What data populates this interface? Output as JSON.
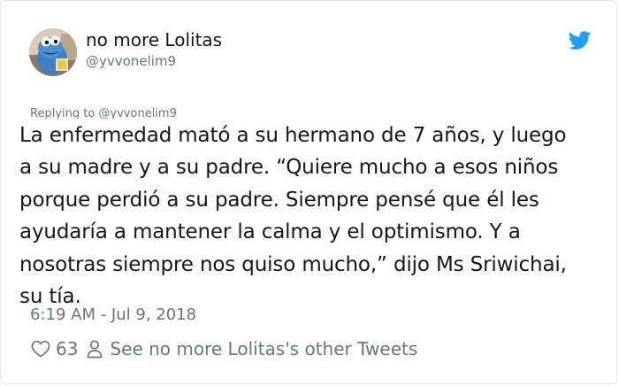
{
  "user": {
    "display_name": "no more Lolitas",
    "handle": "@yvvonelim9"
  },
  "replying_to": "Replying to @yvvonelim9",
  "tweet": {
    "lines": [
      "La enfermedad mató a su hermano de 7 años, y luego",
      "a su madre y a su padre. “Quiere mucho a esos niños",
      "porque perdió a su padre. Siempre pensé que él les",
      "ayudaría a mantener la calma y el optimismo. Y a",
      "nosotras siempre nos quiso mucho,” dijo Ms Sriwichai,",
      "su tía."
    ],
    "timestamp": "6:19 AM - Jul 9, 2018"
  },
  "actions": {
    "like_count": "63",
    "other_tweets_label": "See no more Lolitas's other Tweets"
  },
  "colors": {
    "twitter_blue": "#1da1f2",
    "text_primary": "#14171a",
    "text_secondary": "#657786"
  },
  "icons": {
    "brand": "twitter-bird-icon",
    "like": "heart-icon",
    "profile": "person-icon"
  }
}
